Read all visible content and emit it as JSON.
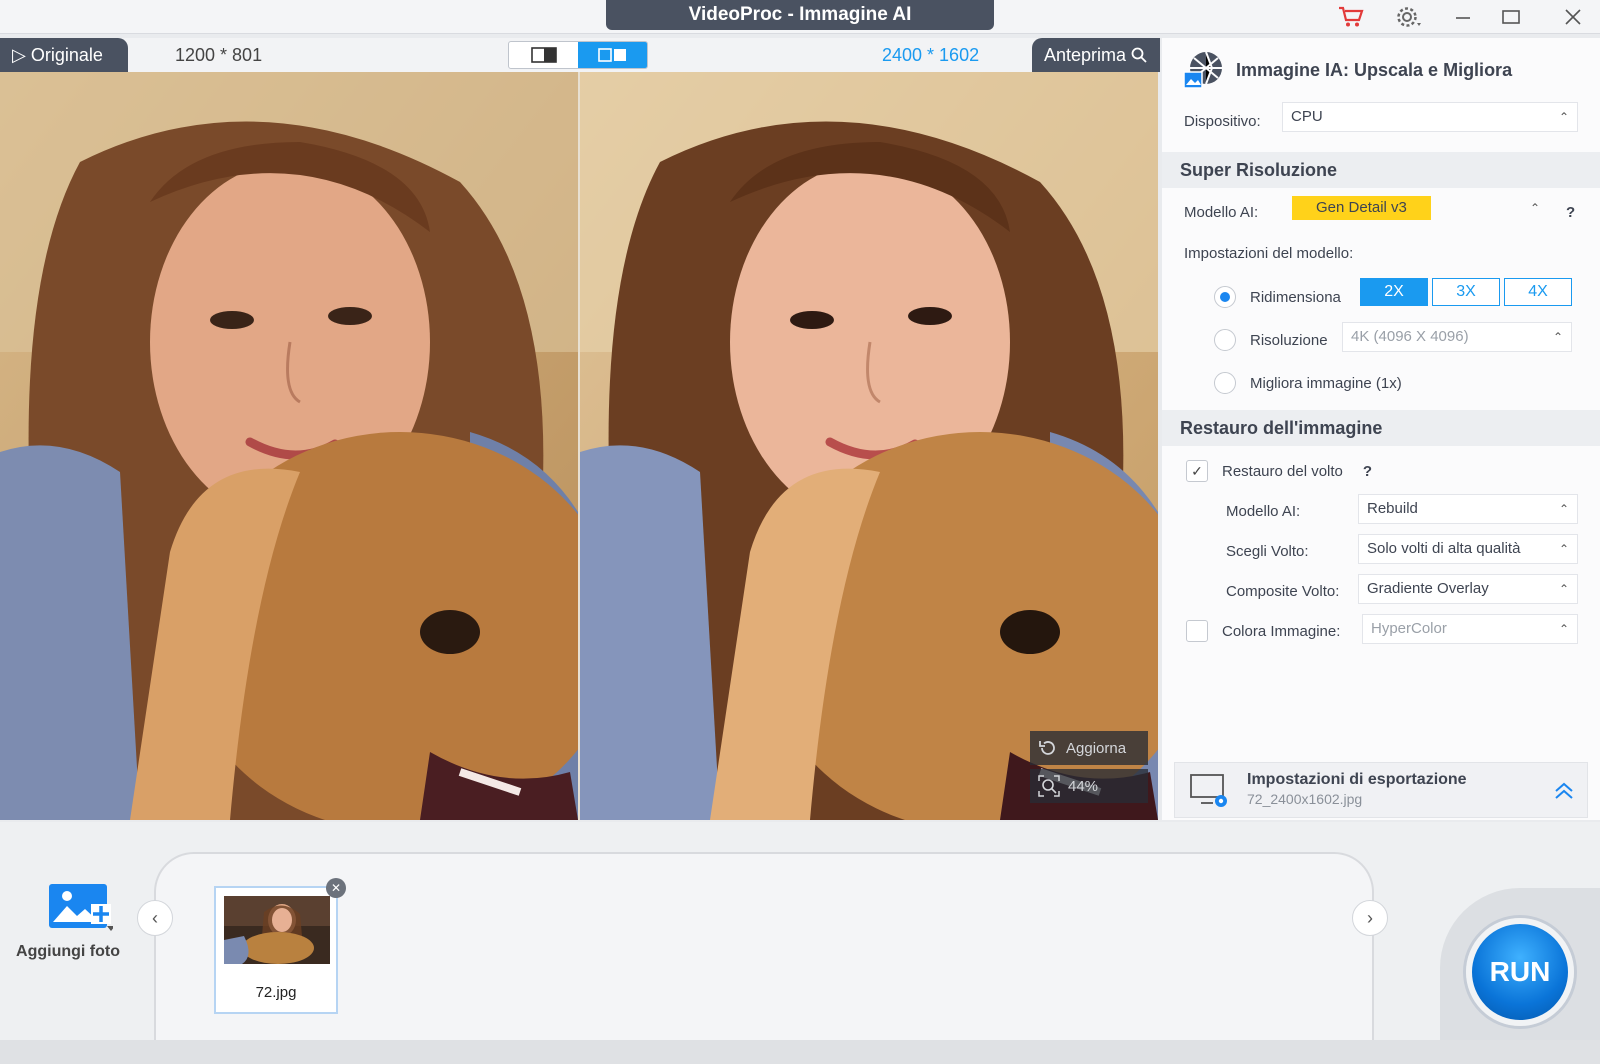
{
  "window": {
    "title": "VideoProc - Immagine AI",
    "icons": [
      "cart-icon",
      "gear-icon",
      "minimize-icon",
      "maximize-icon",
      "close-icon"
    ],
    "accent_color": "#1a9af0",
    "cart_color": "#e23a3a"
  },
  "preview": {
    "original_tab": "Originale",
    "original_size": "1200 * 801",
    "output_size": "2400 * 1602",
    "preview_tab": "Anteprima",
    "overlay": {
      "refresh_label": "Aggiorna",
      "zoom_label": "44%"
    }
  },
  "panel": {
    "title": "Immagine IA: Upscala e Migliora",
    "device_label": "Dispositivo:",
    "device_value": "CPU",
    "super_resolution": {
      "header": "Super Risoluzione",
      "model_label": "Modello AI:",
      "model_value": "Gen Detail v3",
      "help": "?",
      "settings_label": "Impostazioni del modello:",
      "resize_label": "Ridimensiona",
      "scales": [
        "2X",
        "3X",
        "4X"
      ],
      "active_scale": "2X",
      "resolution_label": "Risoluzione",
      "resolution_value": "4K (4096 X 4096)",
      "enhance_label": "Migliora immagine (1x)"
    },
    "restore": {
      "header": "Restauro dell'immagine",
      "face_restore_label": "Restauro del volto",
      "help": "?",
      "model_label": "Modello AI:",
      "model_value": "Rebuild",
      "choose_face_label": "Scegli Volto:",
      "choose_face_value": "Solo volti di alta qualità",
      "composite_label": "Composite Volto:",
      "composite_value": "Gradiente Overlay",
      "colorize_label": "Colora Immagine:",
      "colorize_value": "HyperColor"
    },
    "export": {
      "title": "Impostazioni di esportazione",
      "filename": "72_2400x1602.jpg"
    }
  },
  "bottom": {
    "add_photo_label": "Aggiungi foto",
    "thumbnail_name": "72.jpg",
    "run_label": "RUN"
  }
}
